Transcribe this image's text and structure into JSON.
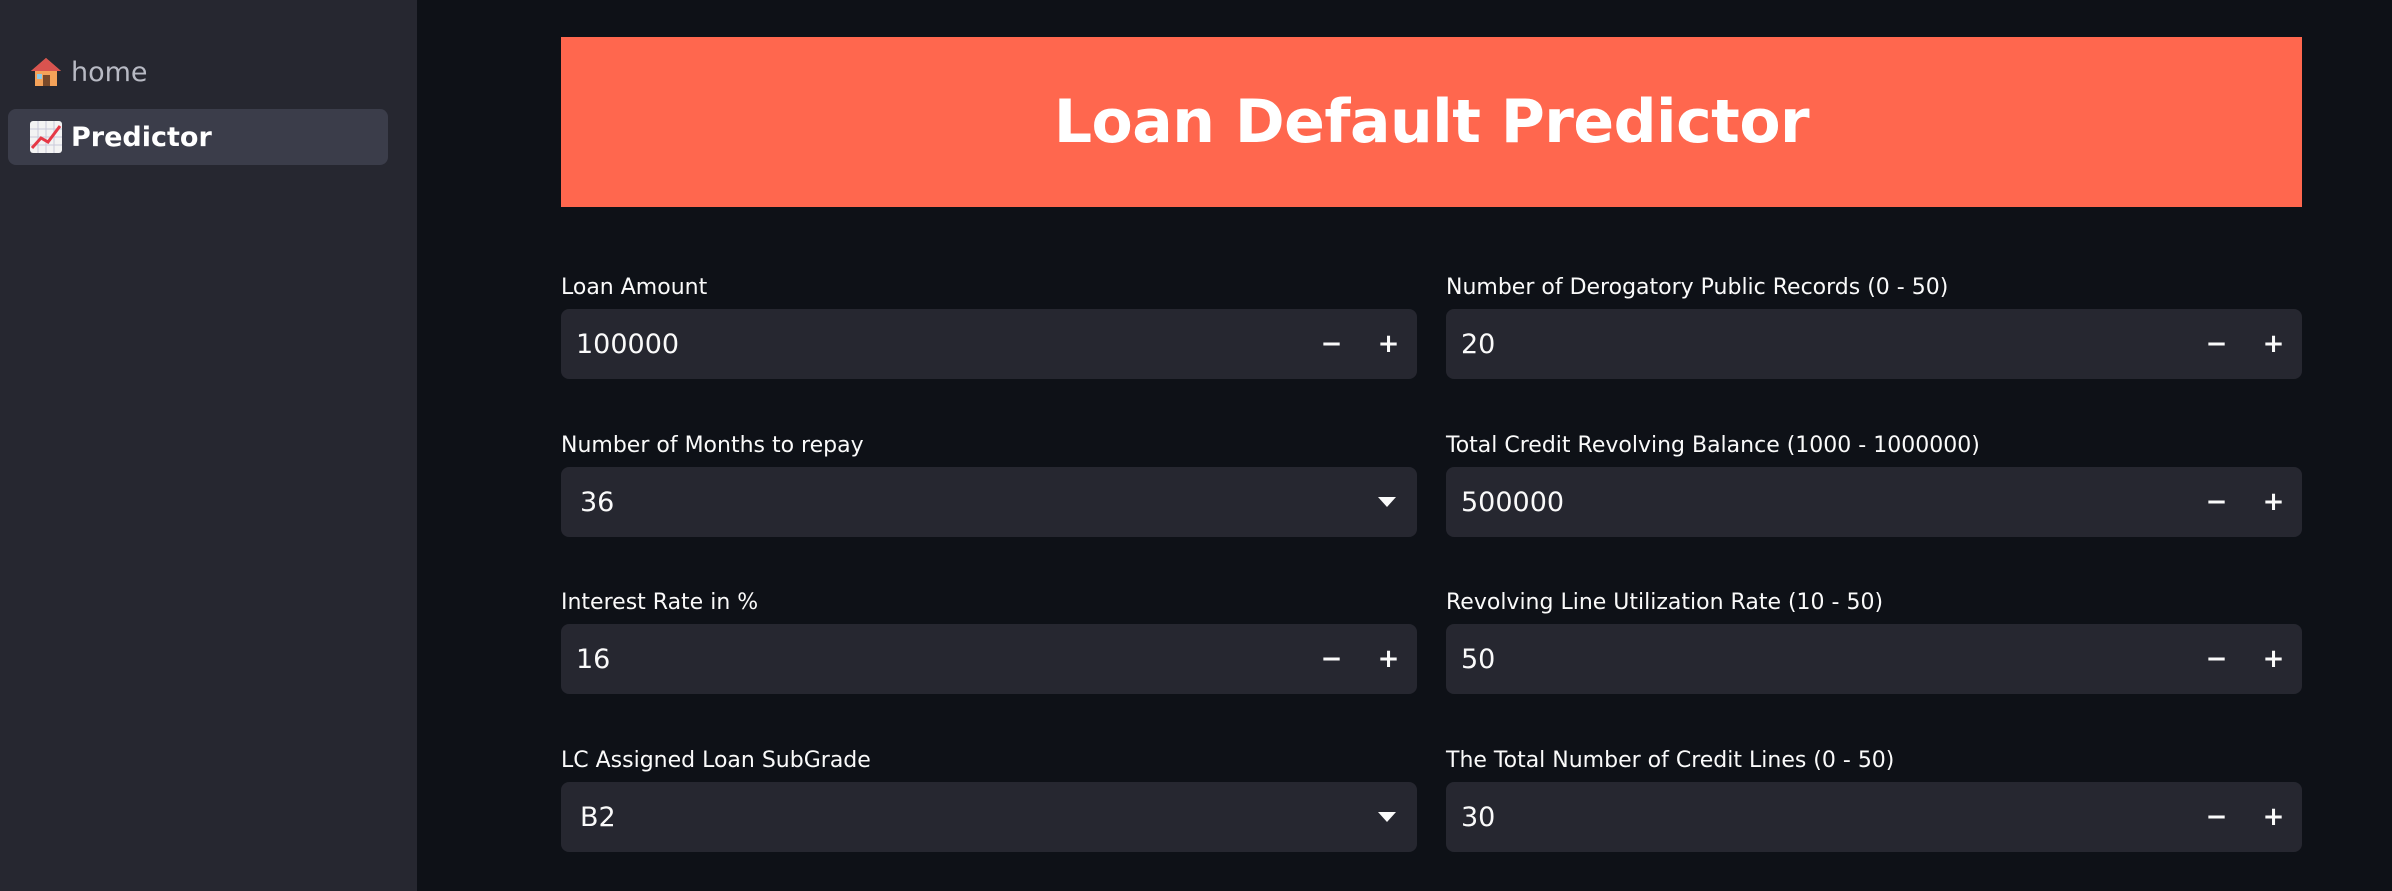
{
  "sidebar": {
    "items": [
      {
        "label": "home",
        "icon": "house-icon",
        "active": false
      },
      {
        "label": "Predictor",
        "icon": "chart-increasing-icon",
        "active": true
      }
    ]
  },
  "banner": {
    "title": "Loan Default Predictor",
    "color": "#ff674e"
  },
  "form": {
    "loan_amount": {
      "label": "Loan Amount",
      "value": "100000"
    },
    "months": {
      "label": "Number of Months to repay",
      "value": "36"
    },
    "interest_rate": {
      "label": "Interest Rate in %",
      "value": "16"
    },
    "subgrade": {
      "label": "LC Assigned Loan SubGrade",
      "value": "B2"
    },
    "derogatory": {
      "label": "Number of Derogatory Public Records (0 - 50)",
      "value": "20"
    },
    "revolving_balance": {
      "label": "Total Credit Revolving Balance (1000 - 1000000)",
      "value": "500000"
    },
    "utilization": {
      "label": "Revolving Line Utilization Rate (10 - 50)",
      "value": "50"
    },
    "credit_lines": {
      "label": "The Total Number of Credit Lines (0 - 50)",
      "value": "30"
    }
  },
  "stepper": {
    "minus": "−",
    "plus": "+"
  }
}
